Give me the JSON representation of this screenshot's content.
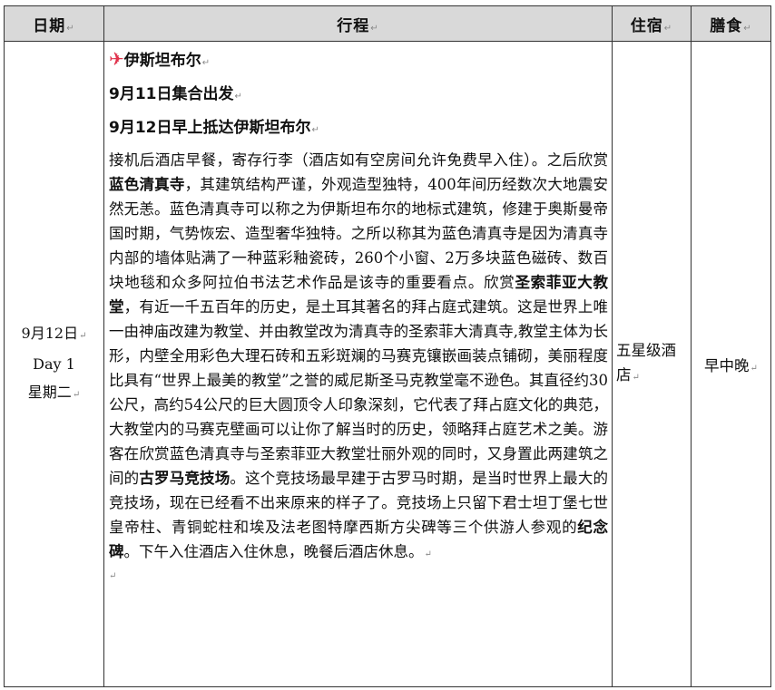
{
  "header": {
    "date": "日期",
    "itinerary": "行程",
    "hotel": "住宿",
    "meals": "膳食"
  },
  "day": {
    "date": "9月12日",
    "day_label": "Day 1",
    "weekday": "星期二"
  },
  "itinerary": {
    "city": "伊斯坦布尔",
    "line1": "9月11日集合出发",
    "line2": "9月12日早上抵达伊斯坦布尔",
    "p1": "接机后酒店早餐，寄存行李（酒店如有空房间允许免费早入住）。之后欣赏",
    "blue_mosque": "蓝色清真寺",
    "p2": "，其建筑结构严谨，外观造型独特，400年间历经数次大地震安然无恙。蓝色清真寺可以称之为伊斯坦布尔的地标式建筑，修建于奥斯曼帝国时期，气势恢宏、造型奢华独特。之所以称其为蓝色清真寺是因为清真寺内部的墙体贴满了一种蓝彩釉瓷砖，260个小窗、2万多块蓝色磁砖、数百块地毯和众多阿拉伯书法艺术作品是该寺的重要看点。欣赏",
    "hagia_sophia": "圣索菲亚大教堂",
    "p3": "，有近一千五百年的历史，是土耳其著名的拜占庭式建筑。这是世界上唯一由神庙改建为教堂、并由教堂改为清真寺的圣索菲大清真寺,教堂主体为长形，内壁全用彩色大理石砖和五彩斑斓的马赛克镶嵌画装点铺砌，美丽程度比具有“世界上最美的教堂”之誉的威尼斯圣马克教堂毫不逊色。其直径约30公尺，高约54公尺的巨大圆顶令人印象深刻，它代表了拜占庭文化的典范，大教堂内的马赛克壁画可以让你了解当时的历史，领略拜占庭艺术之美。游客在欣赏蓝色清真寺与圣索菲亚大教堂壮丽外观的同时，又身置此两建筑之间的",
    "hippodrome": "古罗马竞技场",
    "p4": "。这个竞技场最早建于古罗马时期，是当时世界上最大的竞技场，现在已经看不出来原来的样子了。竞技场上只留下君士坦丁堡七世皇帝柱、青铜蛇柱和埃及法老图特摩西斯方尖碑等三个供游人参观的",
    "monument": "纪念碑",
    "p5": "。下午入住酒店入住休息，晚餐后酒店休息。"
  },
  "hotel": "五星级酒店",
  "meals": "早中晚",
  "plane_icon": "airplane-icon",
  "paragraph_mark": "↵"
}
